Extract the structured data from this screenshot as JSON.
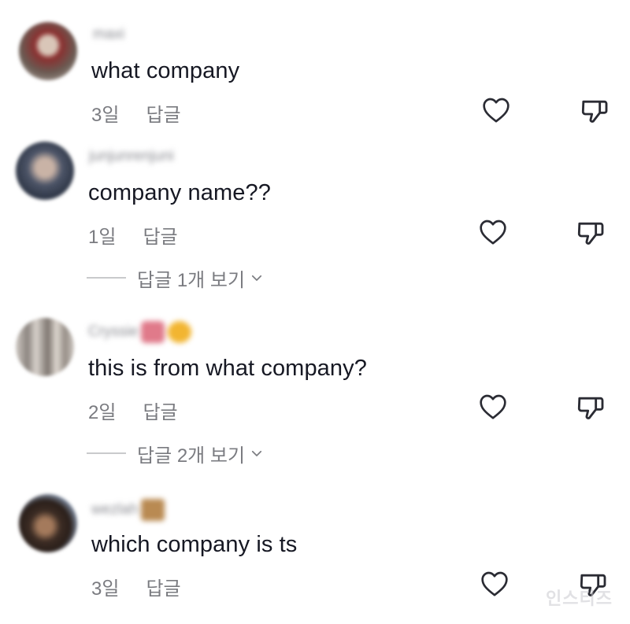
{
  "comments": [
    {
      "username": "maxi",
      "text": "what company",
      "age": "3일",
      "reply_label": "답글",
      "avatar_color": "#8a6a5e"
    },
    {
      "username": "junjunrenjuni",
      "text": "company name??",
      "age": "1일",
      "reply_label": "답글",
      "avatar_color": "#5f6678",
      "view_replies": "답글 1개 보기"
    },
    {
      "username": "Cryssie",
      "text": "this is from what company?",
      "age": "2일",
      "reply_label": "답글",
      "avatar_color": "#a8a3a0",
      "view_replies": "답글 2개 보기"
    },
    {
      "username": "wezlah",
      "text": "which company is ts",
      "age": "3일",
      "reply_label": "답글",
      "avatar_color": "#4a3a32"
    }
  ],
  "watermark": "인스티즈",
  "icons": {
    "like": "heart-outline-icon",
    "dislike": "thumbs-down-icon",
    "expand": "chevron-down-icon"
  }
}
